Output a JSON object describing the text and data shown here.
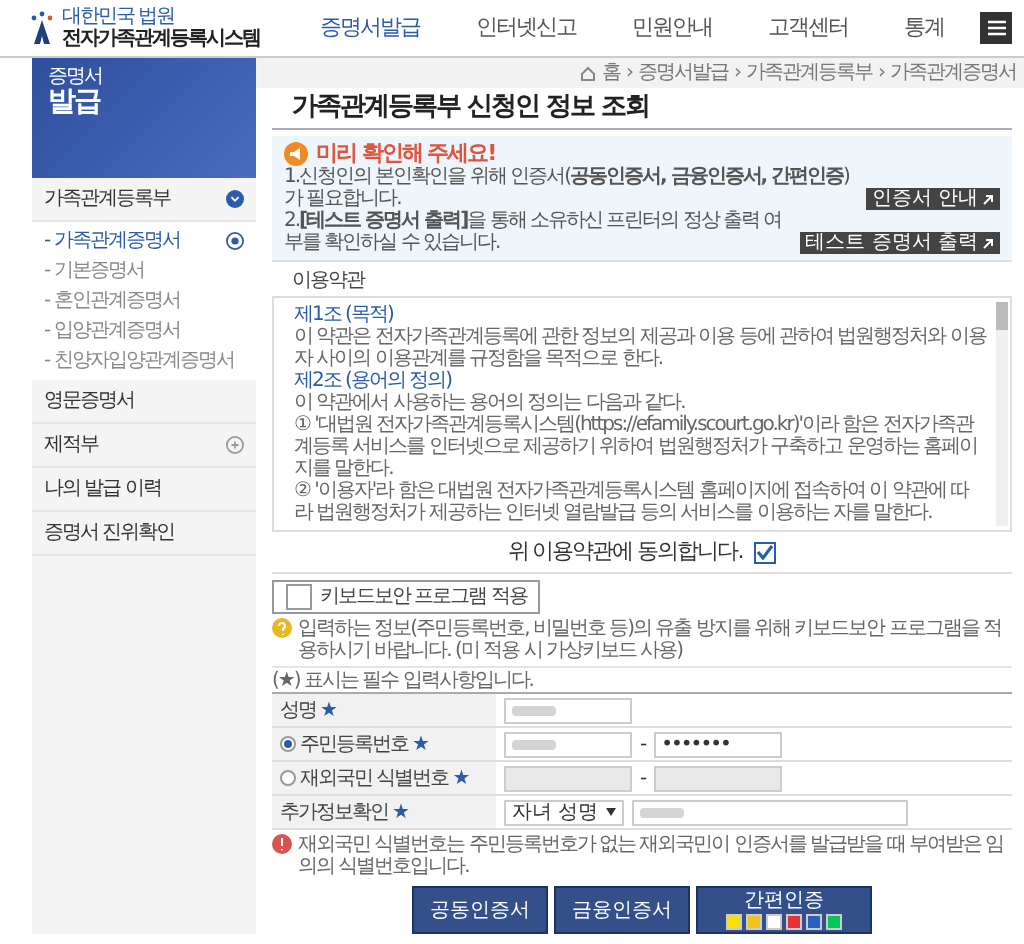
{
  "header": {
    "logo_top": "대한민국 법원",
    "logo_title": "전자가족관계등록시스템",
    "nav": [
      {
        "label": "증명서발급",
        "selected": true
      },
      {
        "label": "인터넷신고",
        "selected": false
      },
      {
        "label": "민원안내",
        "selected": false
      },
      {
        "label": "고객센터",
        "selected": false
      },
      {
        "label": "통계",
        "selected": false
      }
    ]
  },
  "breadcrumb": {
    "separator": "›",
    "items": [
      "홈",
      "증명서발급",
      "가족관계등록부",
      "가족관계증명서"
    ]
  },
  "sidebar": {
    "banner_small": "증명서",
    "banner_big": "발급",
    "items": [
      {
        "kind": "group",
        "label": "가족관계등록부",
        "expanded": true,
        "bullet": "-",
        "children": [
          {
            "label": "가족관계증명서",
            "selected": true
          },
          {
            "label": "기본증명서",
            "selected": false
          },
          {
            "label": "혼인관계증명서",
            "selected": false
          },
          {
            "label": "입양관계증명서",
            "selected": false
          },
          {
            "label": "친양자입양관계증명서",
            "selected": false
          }
        ]
      },
      {
        "kind": "link",
        "label": "영문증명서"
      },
      {
        "kind": "group",
        "label": "제적부",
        "expanded": false
      },
      {
        "kind": "link",
        "label": "나의 발급 이력"
      },
      {
        "kind": "link",
        "label": "증명서 진위확인"
      }
    ]
  },
  "title": "가족관계등록부 신청인 정보 조회",
  "notice": {
    "heading": "미리 확인해 주세요!",
    "items": [
      {
        "text": "1.신청인의 본인확인을 위해 인증서(**공동인증서, 금융인증서, 간편인증**)가 필요합니다.",
        "button": "인증서 안내"
      },
      {
        "text": "2.**[테스트 증명서 출력]**을 통해 소유하신 프린터의 정상 출력 여부를 확인하실 수 있습니다.",
        "button": "테스트 증명서 출력"
      }
    ]
  },
  "terms": {
    "title": "이용약관",
    "articles": [
      {
        "heading": "제1조 (목적)",
        "paragraphs": [
          "이 약관은 전자가족관계등록에 관한 정보의 제공과 이용 등에 관하여 법원행정처와 이용자 사이의 이용관계를 규정함을 목적으로 한다."
        ]
      },
      {
        "heading": "제2조 (용어의 정의)",
        "paragraphs": [
          "이 약관에서 사용하는 용어의 정의는 다음과 같다.",
          "① '대법원 전자가족관계등록시스템(https://efamily.scourt.go.kr)'이라 함은 전자가족관계등록 서비스를 인터넷으로 제공하기 위하여 법원행정처가 구축하고 운영하는 홈페이지를 말한다.",
          "② '이용자'라 함은 대법원 전자가족관계등록시스템 홈페이지에 접속하여 이 약관에 따라 법원행정처가 제공하는 인터넷 열람발급 등의 서비스를 이용하는 자를 말한다."
        ]
      }
    ]
  },
  "agree": {
    "label": "위 이용약관에 동의합니다.",
    "checked": true
  },
  "keyboard_security": {
    "label": "키보드보안 프로그램 적용",
    "checked": false
  },
  "keyboard_notice": "입력하는 정보(주민등록번호, 비밀번호 등)의 유출 방지를 위해 키보드보안 프로그램을 적용하시기 바랍니다. (미 적용 시 가상키보드 사용)",
  "required_note": "(★) 표시는 필수 입력사항입니다.",
  "form": {
    "rows": [
      {
        "kind": "text",
        "label": "성명",
        "required_mark": "★"
      },
      {
        "kind": "radio",
        "label": "주민등록번호",
        "required_mark": "★",
        "selected": true,
        "separator": "-",
        "masked_value": "•••••••"
      },
      {
        "kind": "radio",
        "label": "재외국민 식별번호",
        "required_mark": "★",
        "selected": false,
        "separator": "-"
      },
      {
        "kind": "select",
        "label": "추가정보확인",
        "required_mark": "★",
        "select_value": "자녀 성명"
      }
    ]
  },
  "warning": "재외국민 식별번호는 주민등록번호가 없는 재외국민이 인증서를 발급받을 때 부여받은 임의의 식별번호입니다.",
  "auth_buttons": [
    {
      "kind": "plain",
      "label": "공동인증서"
    },
    {
      "kind": "plain",
      "label": "금융인증서"
    },
    {
      "kind": "providers",
      "label": "간편인증",
      "providers": [
        {
          "color": "#f9e000"
        },
        {
          "color": "#f0c419"
        },
        {
          "color": "#ffffff"
        },
        {
          "color": "#e8303a"
        },
        {
          "color": "#2b5fbf"
        },
        {
          "color": "#03c75a"
        }
      ]
    }
  ]
}
